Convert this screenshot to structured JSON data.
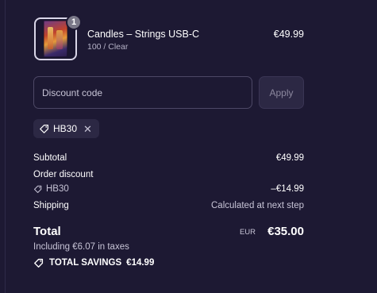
{
  "product": {
    "quantity": "1",
    "name": "Candles – Strings USB-C",
    "variant": "100 / Clear",
    "price": "€49.99"
  },
  "discount": {
    "placeholder": "Discount code",
    "apply_label": "Apply",
    "applied_code": "HB30"
  },
  "summary": {
    "subtotal_label": "Subtotal",
    "subtotal_value": "€49.99",
    "order_discount_label": "Order discount",
    "discount_code": "HB30",
    "discount_value": "–€14.99",
    "shipping_label": "Shipping",
    "shipping_value": "Calculated at next step",
    "total_label": "Total",
    "currency": "EUR",
    "total_value": "€35.00",
    "taxes_text": "Including €6.07 in taxes",
    "savings_label": "TOTAL SAVINGS",
    "savings_value": "€14.99"
  },
  "icons": {
    "tag": "tag-icon",
    "remove": "close-icon"
  },
  "colors": {
    "background": "#1d1933",
    "chip_background": "#2c2844",
    "muted_text": "#c7c4d6"
  }
}
